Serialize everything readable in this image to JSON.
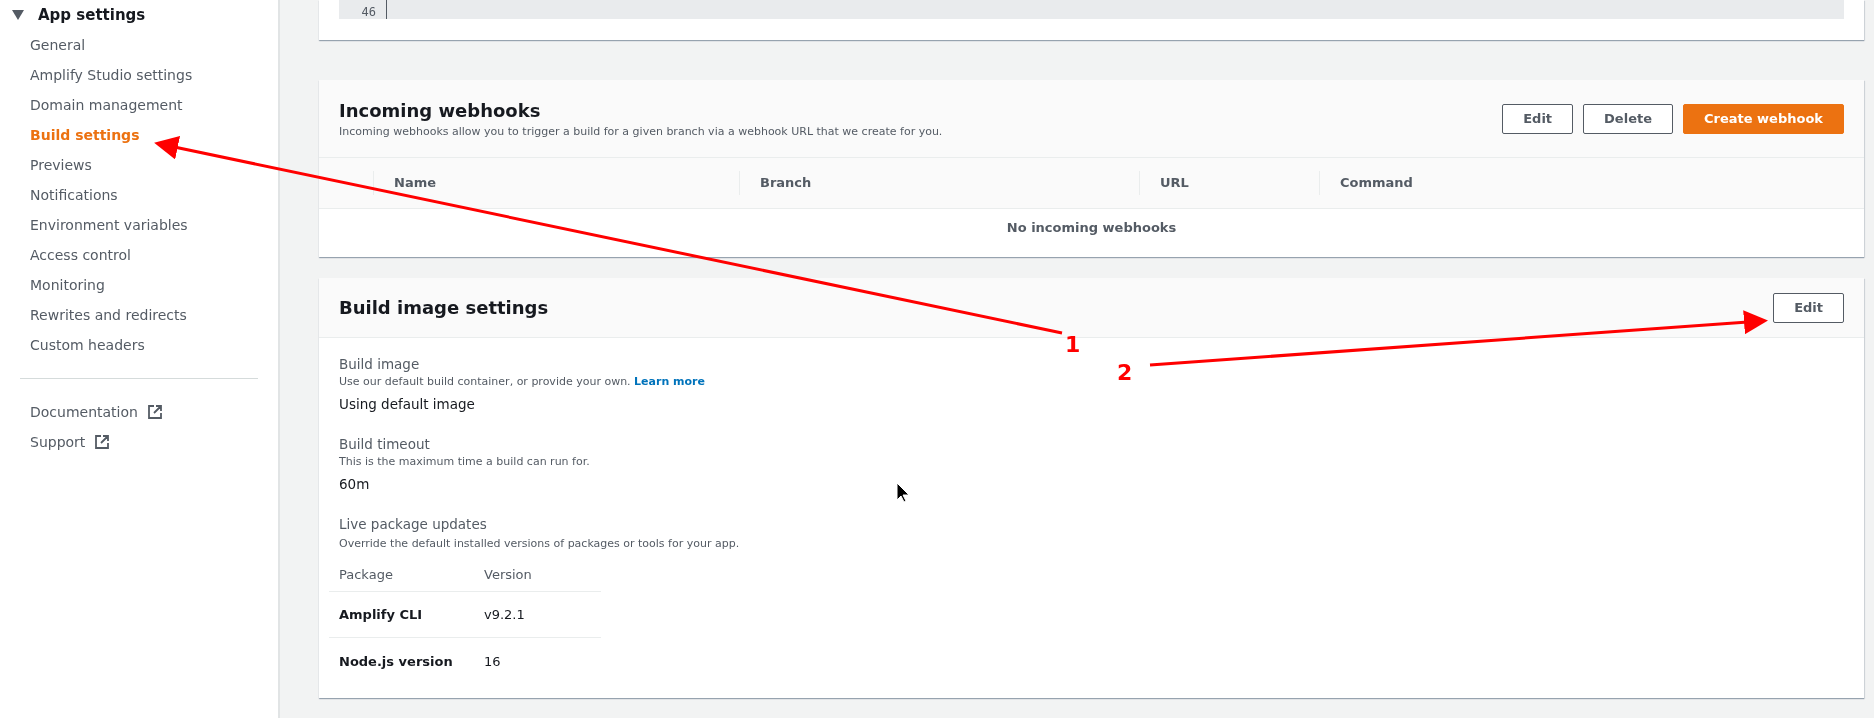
{
  "sidebar": {
    "section": {
      "label": "App settings",
      "expanded": true
    },
    "items": [
      {
        "label": "General",
        "selected": false
      },
      {
        "label": "Amplify Studio settings",
        "selected": false
      },
      {
        "label": "Domain management",
        "selected": false
      },
      {
        "label": "Build settings",
        "selected": true
      },
      {
        "label": "Previews",
        "selected": false
      },
      {
        "label": "Notifications",
        "selected": false
      },
      {
        "label": "Environment variables",
        "selected": false
      },
      {
        "label": "Access control",
        "selected": false
      },
      {
        "label": "Monitoring",
        "selected": false
      },
      {
        "label": "Rewrites and redirects",
        "selected": false
      },
      {
        "label": "Custom headers",
        "selected": false
      }
    ],
    "links": [
      {
        "label": "Documentation",
        "external": true
      },
      {
        "label": "Support",
        "external": true
      }
    ]
  },
  "code_editor": {
    "line_numbers": [
      "46"
    ]
  },
  "incoming_webhooks": {
    "title": "Incoming webhooks",
    "description": "Incoming webhooks allow you to trigger a build for a given branch via a webhook URL that we create for you.",
    "buttons": [
      {
        "label": "Edit",
        "kind": "normal"
      },
      {
        "label": "Delete",
        "kind": "normal"
      },
      {
        "label": "Create webhook",
        "kind": "primary"
      }
    ],
    "table": {
      "columns": [
        "Name",
        "Branch",
        "URL",
        "Command"
      ],
      "empty_text": "No incoming webhooks"
    }
  },
  "build_image_settings": {
    "title": "Build image settings",
    "edit_button": "Edit",
    "fields": [
      {
        "label": "Build image",
        "description": "Use our default build container, or provide your own.",
        "link": "Learn more",
        "value": "Using default image"
      },
      {
        "label": "Build timeout",
        "description": "This is the maximum time a build can run for.",
        "value": "60m"
      }
    ],
    "live_package_updates": {
      "label": "Live package updates",
      "description": "Override the default installed versions of packages or tools for your app.",
      "columns": [
        "Package",
        "Version"
      ],
      "rows": [
        {
          "package": "Amplify CLI",
          "version": "v9.2.1"
        },
        {
          "package": "Node.js version",
          "version": "16"
        }
      ]
    }
  },
  "annotations": [
    {
      "number": "1"
    },
    {
      "number": "2"
    }
  ]
}
